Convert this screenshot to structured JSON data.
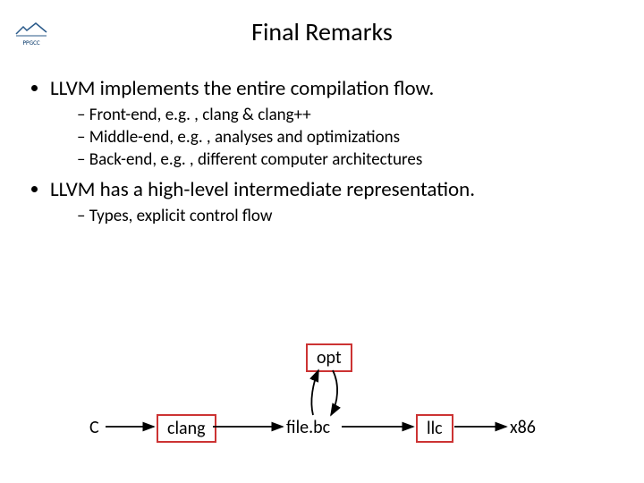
{
  "logo": {
    "text": "PPGCC"
  },
  "title": "Final Remarks",
  "bullets": [
    {
      "text": "LLVM implements the entire compilation flow.",
      "sub": [
        "Front-end, e.g. , clang & clang++",
        "Middle-end, e.g. , analyses and optimizations",
        "Back-end, e.g. , different computer architectures"
      ]
    },
    {
      "text": "LLVM has a high-level intermediate representation.",
      "sub": [
        "Types, explicit control flow"
      ]
    }
  ],
  "diagram": {
    "nodes": {
      "c": "C",
      "clang": "clang",
      "filebc": "file.bc",
      "opt": "opt",
      "llc": "llc",
      "x86": "x86"
    }
  }
}
